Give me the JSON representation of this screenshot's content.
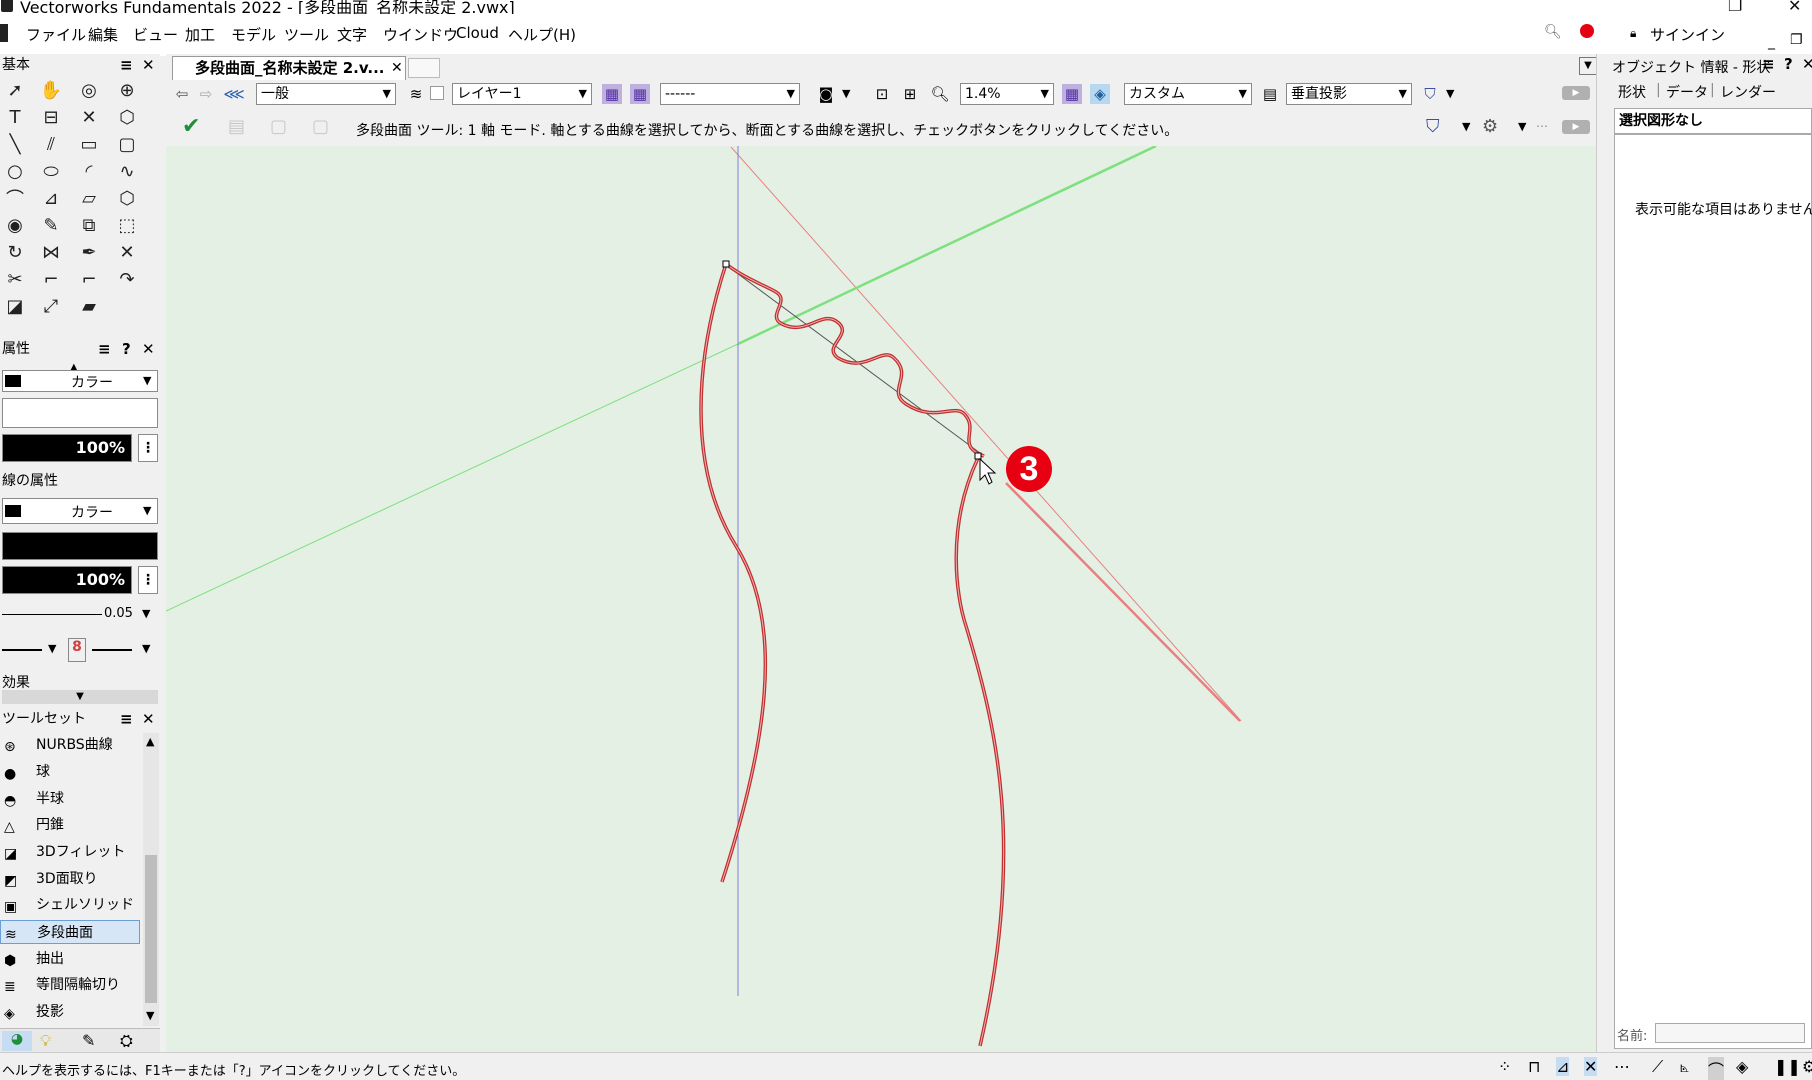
{
  "window": {
    "title": "Vectorworks Fundamentals 2022 - [多段曲面_名称未設定 2.vwx]"
  },
  "menu": [
    "ファイル",
    "編集",
    "ビュー",
    "加工",
    "モデル",
    "ツール",
    "文字",
    "ウインドウ",
    "Cloud",
    "ヘルプ(H)"
  ],
  "signin_label": "サインイン",
  "basic_palette": {
    "title": "基本"
  },
  "attributes": {
    "title": "属性",
    "fill_type": "カラー",
    "fill_opacity": "100%",
    "line_section_title": "線の属性",
    "line_type": "カラー",
    "line_opacity": "100%",
    "line_thickness": "0.05",
    "effects_title": "効果"
  },
  "toolsets": {
    "title": "ツールセット",
    "items": [
      "NURBS曲線",
      "球",
      "半球",
      "円錐",
      "3Dフィレット",
      "3D面取り",
      "シェルソリッド",
      "多段曲面",
      "抽出",
      "等間隔輪切り",
      "投影"
    ],
    "selected_index": 7
  },
  "document": {
    "tab_label": "多段曲面_名称未設定 2.v..."
  },
  "viewbar": {
    "class": "一般",
    "layer": "レイヤー1",
    "empty_dd": "------",
    "zoom": "1.4%",
    "view": "カスタム",
    "projection": "垂直投影"
  },
  "modebar": {
    "message": "多段曲面 ツール: 1 軸 モード. 軸とする曲線を選択してから、断面とする曲線を選択し、チェックボタンをクリックしてください。"
  },
  "annotation": {
    "step": "3"
  },
  "oip": {
    "title": "オブジェクト 情報 - 形状",
    "tabs": [
      "形状",
      "データ",
      "レンダー"
    ],
    "selection": "選択図形なし",
    "empty_message": "表示可能な項目はありません",
    "name_label": "名前:"
  },
  "statusbar": {
    "text": "ヘルプを表示するには、F1キーまたは「?」アイコンをクリックしてください。"
  },
  "colors": {
    "canvas": "#e5f0e5",
    "curve": "#d04040",
    "x_axis": "#e88080",
    "y_axis": "#7ee07e",
    "z_axis": "#8080e0",
    "badge": "#e60012"
  }
}
